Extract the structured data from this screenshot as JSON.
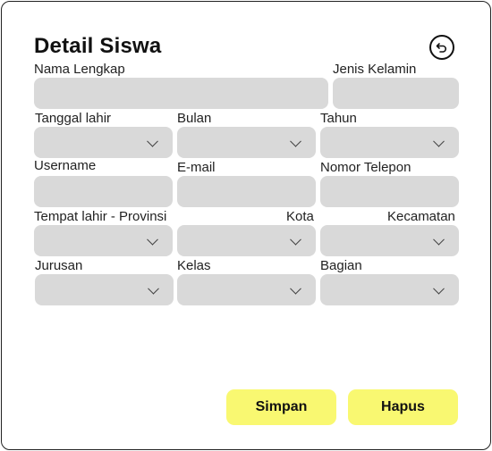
{
  "form": {
    "title": "Detail Siswa",
    "labels": {
      "nama_lengkap": "Nama Lengkap",
      "jenis_kelamin": "Jenis Kelamin",
      "tanggal_lahir": "Tanggal lahir",
      "bulan": "Bulan",
      "tahun": "Tahun",
      "username": "Username",
      "email": "E-mail",
      "nomor_telepon": "Nomor Telepon",
      "tempat_lahir_provinsi": "Tempat lahir - Provinsi",
      "kota": "Kota",
      "kecamatan": "Kecamatan",
      "jurusan": "Jurusan",
      "kelas": "Kelas",
      "bagian": "Bagian"
    },
    "buttons": {
      "simpan": "Simpan",
      "hapus": "Hapus"
    },
    "icons": {
      "back": "undo-arrow-icon",
      "dropdown": "chevron-down-icon"
    },
    "colors": {
      "field_bg": "#d9d9d9",
      "button_bg": "#f9f871",
      "border": "#222222"
    }
  }
}
